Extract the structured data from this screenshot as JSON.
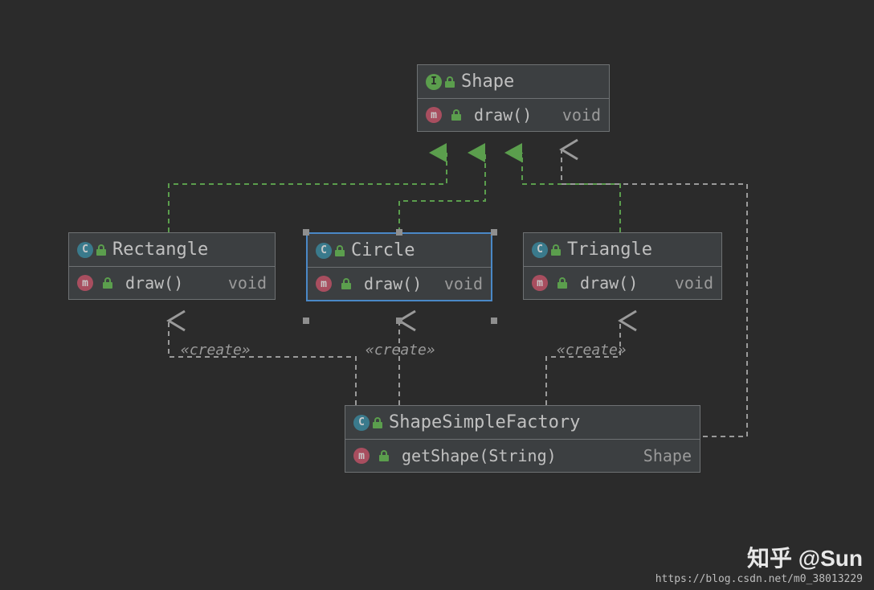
{
  "boxes": {
    "shape": {
      "name": "Shape",
      "kind": "interface",
      "method": "draw()",
      "returns": "void"
    },
    "rectangle": {
      "name": "Rectangle",
      "kind": "class",
      "method": "draw()",
      "returns": "void"
    },
    "circle": {
      "name": "Circle",
      "kind": "class",
      "method": "draw()",
      "returns": "void",
      "selected": true
    },
    "triangle": {
      "name": "Triangle",
      "kind": "class",
      "method": "draw()",
      "returns": "void"
    },
    "factory": {
      "name": "ShapeSimpleFactory",
      "kind": "class",
      "method": "getShape(String)",
      "returns": "Shape"
    }
  },
  "labels": {
    "create": "«create»"
  },
  "watermark": {
    "title": "知乎 @Sun",
    "url": "https://blog.csdn.net/m0_38013229"
  }
}
